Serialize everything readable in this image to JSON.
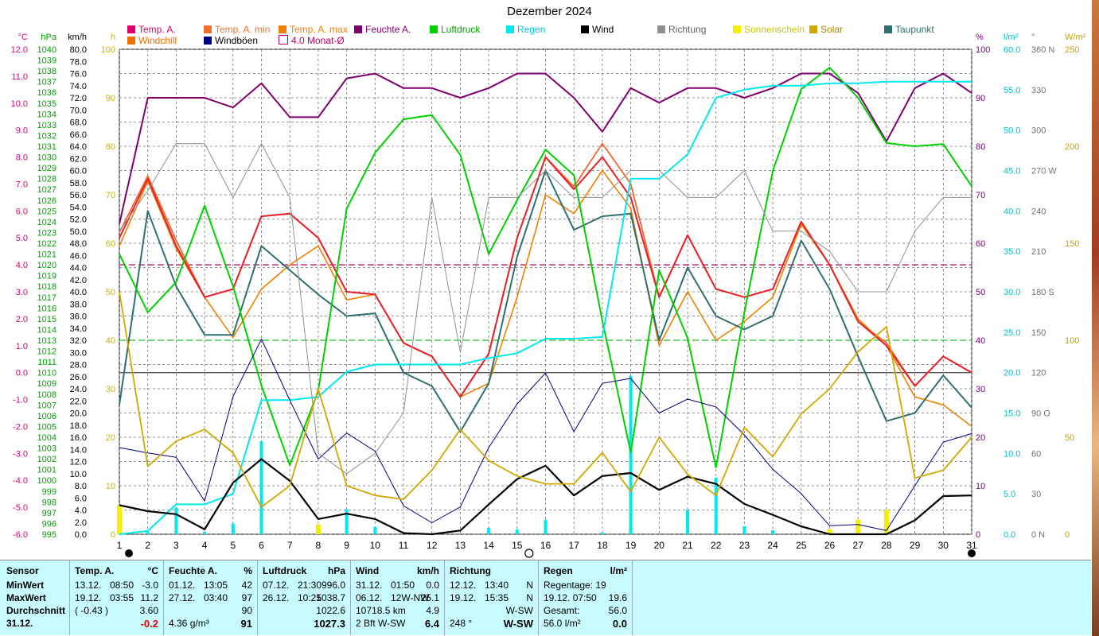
{
  "chart_data": {
    "type": "line",
    "title": "Dezember 2024",
    "x": [
      1,
      2,
      3,
      4,
      5,
      6,
      7,
      8,
      9,
      10,
      11,
      12,
      13,
      14,
      15,
      16,
      17,
      18,
      19,
      20,
      21,
      22,
      23,
      24,
      25,
      26,
      27,
      28,
      29,
      30,
      31
    ],
    "x_tick_labels": [
      "1",
      "2",
      "3",
      "4",
      "5",
      "6",
      "7",
      "8",
      "9",
      "10",
      "11",
      "12",
      "13",
      "14",
      "15",
      "16",
      "17",
      "18",
      "19",
      "20",
      "21",
      "22",
      "23",
      "24",
      "25",
      "26",
      "27",
      "28",
      "29",
      "30",
      "31"
    ],
    "axes": {
      "temp_c": {
        "label": "°C",
        "min": -6,
        "max": 12,
        "ticks": [
          "12.0",
          "11.0",
          "10.0",
          "9.0",
          "8.0",
          "7.0",
          "6.0",
          "5.0",
          "4.0",
          "3.0",
          "2.0",
          "1.0",
          "0.0",
          "-1.0",
          "-2.0",
          "-3.0",
          "-4.0",
          "-5.0",
          "-6.0"
        ],
        "color": "#e0007a"
      },
      "pressure_hpa": {
        "label": "hPa",
        "min": 995,
        "max": 1040,
        "ticks": [
          "1040",
          "1039",
          "1038",
          "1037",
          "1036",
          "1035",
          "1034",
          "1033",
          "1032",
          "1031",
          "1030",
          "1029",
          "1028",
          "1027",
          "1026",
          "1025",
          "1024",
          "1023",
          "1022",
          "1021",
          "1020",
          "1019",
          "1018",
          "1017",
          "1016",
          "1015",
          "1014",
          "1013",
          "1012",
          "1011",
          "1010",
          "1009",
          "1008",
          "1007",
          "1006",
          "1005",
          "1004",
          "1003",
          "1002",
          "1001",
          "1000",
          "999",
          "998",
          "997",
          "996",
          "995"
        ],
        "color": "#00a000"
      },
      "wind_kmh": {
        "label": "km/h",
        "min": 0,
        "max": 80,
        "ticks": [
          "80.0",
          "78.0",
          "76.0",
          "74.0",
          "72.0",
          "70.0",
          "68.0",
          "66.0",
          "64.0",
          "62.0",
          "60.0",
          "58.0",
          "56.0",
          "54.0",
          "52.0",
          "50.0",
          "48.0",
          "46.0",
          "44.0",
          "42.0",
          "40.0",
          "38.0",
          "36.0",
          "34.0",
          "32.0",
          "30.0",
          "28.0",
          "26.0",
          "24.0",
          "22.0",
          "20.0",
          "18.0",
          "16.0",
          "14.0",
          "12.0",
          "10.0",
          "8.0",
          "6.0",
          "4.0",
          "2.0",
          "0.0"
        ],
        "color": "#000000"
      },
      "sun_h": {
        "label": "h",
        "min": 0,
        "max": 100,
        "ticks": [
          "100",
          "90",
          "80",
          "70",
          "60",
          "50",
          "40",
          "30",
          "20",
          "10",
          "0"
        ],
        "color": "#c8b400"
      },
      "humidity_pct": {
        "label": "%",
        "min": 0,
        "max": 100,
        "ticks": [
          "100",
          "90",
          "80",
          "70",
          "60",
          "50",
          "40",
          "30",
          "20",
          "10",
          "0"
        ],
        "color": "#800080"
      },
      "rain_lm2": {
        "label": "l/m²",
        "min": 0,
        "max": 60,
        "ticks": [
          "60.0",
          "55.0",
          "50.0",
          "45.0",
          "40.0",
          "35.0",
          "30.0",
          "25.0",
          "20.0",
          "15.0",
          "10.0",
          "5.0",
          "0.0"
        ],
        "color": "#00c0d0"
      },
      "direction_deg": {
        "label": "°",
        "min": 0,
        "max": 360,
        "ticks": [
          "360 N",
          "330",
          "300",
          "270 W",
          "240",
          "210",
          "180 S",
          "150",
          "120",
          "90 O",
          "60",
          "30",
          "0 N"
        ],
        "color": "#707070"
      },
      "solar_wm2": {
        "label": "W/m²",
        "min": 0,
        "max": 250,
        "ticks": [
          "250",
          "200",
          "150",
          "100",
          "50",
          "0"
        ],
        "color": "#c8a000"
      }
    },
    "legend": [
      {
        "name": "Temp. A.",
        "color": "#e0006a"
      },
      {
        "name": "Temp. A. min",
        "color": "#f07030"
      },
      {
        "name": "Temp. A. max",
        "color": "#f08000"
      },
      {
        "name": "Feuchte A.",
        "color": "#800070"
      },
      {
        "name": "Luftdruck",
        "color": "#00d000"
      },
      {
        "name": "Regen",
        "color": "#00e8f0"
      },
      {
        "name": "Wind",
        "color": "#000000"
      },
      {
        "name": "Richtung",
        "color": "#909090"
      },
      {
        "name": "Sonnenschein",
        "color": "#f0f000"
      },
      {
        "name": "Solar",
        "color": "#d0a800"
      },
      {
        "name": "Taupunkt",
        "color": "#2f6f6f"
      },
      {
        "name": "Windchill",
        "color": "#f07000"
      },
      {
        "name": "Windböen",
        "color": "#000080"
      },
      {
        "name": "4.0 Monat-Ø",
        "color": "#c00060"
      }
    ],
    "reference_lines": {
      "monthly_mean_temp": 4.0,
      "dewpoint_mean": 1.2
    },
    "series": [
      {
        "name": "Temp. A. min",
        "axis": "temp_c",
        "color": "#f06a30",
        "values": [
          5.2,
          7.3,
          4.9,
          2.8,
          3.1,
          5.8,
          5.9,
          5.0,
          3.0,
          2.9,
          1.1,
          0.6,
          -0.9,
          0.7,
          5.0,
          8.0,
          6.9,
          8.5,
          7.0,
          2.8,
          5.1,
          3.1,
          2.8,
          3.1,
          5.6,
          4.0,
          1.9,
          1.1,
          -0.5,
          0.6,
          0.0
        ]
      },
      {
        "name": "Temp. A. max",
        "axis": "temp_c",
        "color": "#f08000",
        "values": [
          4.7,
          7.1,
          4.6,
          2.8,
          1.3,
          3.1,
          4.0,
          4.7,
          2.7,
          2.9,
          1.1,
          0.6,
          -0.9,
          -0.4,
          2.8,
          6.6,
          5.9,
          7.5,
          6.1,
          1.0,
          3.0,
          1.2,
          1.9,
          2.8,
          5.5,
          4.0,
          2.0,
          1.0,
          -0.9,
          -1.2,
          -2.0
        ]
      },
      {
        "name": "Temp. A.",
        "axis": "temp_c",
        "color": "#e8202a",
        "values": [
          5.0,
          7.2,
          4.7,
          2.8,
          3.1,
          5.8,
          5.9,
          5.0,
          3.0,
          2.9,
          1.1,
          0.6,
          -0.9,
          0.7,
          5.0,
          8.0,
          6.8,
          8.0,
          6.5,
          2.8,
          5.1,
          3.1,
          2.8,
          3.1,
          5.6,
          4.0,
          1.9,
          1.0,
          -0.5,
          0.6,
          0.0
        ]
      },
      {
        "name": "Taupunkt",
        "axis": "temp_c",
        "color": "#2f6f6f",
        "values": [
          -1.2,
          6.0,
          3.2,
          1.4,
          1.4,
          4.7,
          3.8,
          2.9,
          2.1,
          2.2,
          0.0,
          -0.5,
          -2.2,
          -0.4,
          4.3,
          7.5,
          5.3,
          5.8,
          5.9,
          1.2,
          3.9,
          2.1,
          1.6,
          2.1,
          4.9,
          3.1,
          0.6,
          -1.8,
          -1.5,
          -0.1,
          -1.3
        ]
      },
      {
        "name": "Feuchte A.",
        "axis": "humidity_pct",
        "color": "#800070",
        "values": [
          64,
          90,
          90,
          90,
          88,
          93,
          86,
          86,
          94,
          95,
          92,
          92,
          90,
          92,
          95,
          95,
          90,
          83,
          92,
          89,
          92,
          92,
          90,
          92,
          95,
          95,
          91,
          81,
          92,
          95,
          91
        ]
      },
      {
        "name": "Luftdruck",
        "axis": "pressure_hpa",
        "color": "#00d000",
        "values": [
          1021.0,
          1015.6,
          1018.4,
          1025.5,
          1018.0,
          1008.8,
          1001.4,
          1008.3,
          1025.2,
          1030.4,
          1033.5,
          1033.9,
          1030.2,
          1021.0,
          1026.0,
          1030.7,
          1028.3,
          1014.8,
          1002.6,
          1019.5,
          1013.2,
          1001.2,
          1015.6,
          1028.7,
          1036.3,
          1038.3,
          1035.5,
          1031.3,
          1031.0,
          1031.2,
          1027.3
        ]
      },
      {
        "name": "Regen",
        "axis": "rain_lm2",
        "color": "#00e8f0",
        "values": [
          0.0,
          0.4,
          3.7,
          3.7,
          5.0,
          16.6,
          16.6,
          17.0,
          20.1,
          21.0,
          21.0,
          21.0,
          21.0,
          21.8,
          22.4,
          24.2,
          24.2,
          24.4,
          44.0,
          44.0,
          47.0,
          54.0,
          55.0,
          55.5,
          55.5,
          55.8,
          55.8,
          56.0,
          56.0,
          56.0,
          56.0
        ]
      },
      {
        "name": "Wind",
        "axis": "wind_kmh",
        "color": "#000000",
        "values": [
          4.8,
          3.8,
          3.3,
          0.8,
          8.5,
          12.4,
          8.8,
          2.5,
          3.4,
          2.5,
          0.2,
          0.0,
          0.6,
          4.9,
          9.1,
          11.3,
          6.4,
          9.6,
          10.1,
          7.3,
          9.5,
          8.3,
          5.0,
          3.2,
          1.3,
          0.0,
          0.0,
          0.0,
          2.3,
          6.3,
          6.4
        ]
      },
      {
        "name": "Windböen",
        "axis": "wind_kmh",
        "color": "#000080",
        "values": [
          14.3,
          13.4,
          12.7,
          5.5,
          22.7,
          32.2,
          22.1,
          12.4,
          16.7,
          13.7,
          4.7,
          1.9,
          4.5,
          14.3,
          21.5,
          26.6,
          16.9,
          24.9,
          25.7,
          20.0,
          22.3,
          21.0,
          16.4,
          10.7,
          6.7,
          1.4,
          1.6,
          0.6,
          8.0,
          15.2,
          16.6
        ]
      },
      {
        "name": "Richtung",
        "axis": "direction_deg",
        "color": "#909090",
        "values": [
          225,
          255,
          290,
          290,
          250,
          290,
          250,
          60,
          45,
          60,
          90,
          250,
          135,
          250,
          250,
          270,
          250,
          250,
          270,
          270,
          250,
          250,
          270,
          225,
          225,
          210,
          180,
          180,
          225,
          250,
          250
        ]
      },
      {
        "name": "Solar",
        "axis": "solar_wm2",
        "color": "#d0a800",
        "values": [
          125,
          35,
          48,
          54,
          42,
          14,
          25,
          75,
          25,
          20,
          18,
          33,
          54,
          38,
          30,
          26,
          26,
          42,
          22,
          50,
          31,
          20,
          55,
          40,
          62,
          75,
          94,
          107,
          29,
          33,
          50
        ]
      }
    ],
    "rain_bars": {
      "name": "Regen (Tagesmenge)",
      "axis": "rain_lm2",
      "color": "#00e8f0",
      "values": [
        2.0,
        0.3,
        3.3,
        0.3,
        1.3,
        11.5,
        0.0,
        0.4,
        3.1,
        0.9,
        0.0,
        0.0,
        0.0,
        0.8,
        0.6,
        1.8,
        0.0,
        0.2,
        19.6,
        0.0,
        3.0,
        7.0,
        1.0,
        0.5,
        0.0,
        0.3,
        0.0,
        0.2,
        0.0,
        0.0,
        0.0
      ]
    },
    "sun_bars": {
      "name": "Sonnenschein",
      "axis": "sun_h",
      "color": "#f0f000",
      "values": [
        6,
        0,
        0,
        0,
        0,
        0,
        0,
        2,
        0,
        0,
        0,
        0,
        0,
        0,
        0,
        0,
        0,
        0,
        0,
        0,
        0,
        0,
        0,
        0,
        0,
        1,
        3,
        5,
        0,
        0,
        0
      ]
    },
    "grid": true
  },
  "stats": {
    "col1": {
      "header": "Sensor",
      "rows": [
        "MinWert",
        "MaxWert",
        "Durchschnitt",
        "31.12."
      ]
    },
    "col2": {
      "header": "Temp. A.",
      "unit": "°C",
      "rows": [
        [
          "13.12.",
          "08:50",
          "-3.0"
        ],
        [
          "19.12.",
          "03:55",
          "11.2"
        ],
        [
          "( -0.43 )",
          "",
          "3.60"
        ],
        [
          "",
          "",
          "-0.2"
        ]
      ]
    },
    "col3": {
      "header": "Feuchte A.",
      "unit": "%",
      "rows": [
        [
          "01.12.",
          "13:05",
          "42"
        ],
        [
          "27.12.",
          "03:40",
          "97"
        ],
        [
          "",
          "",
          "90"
        ],
        [
          "4.36 g/m³",
          "",
          "91"
        ]
      ]
    },
    "col4": {
      "header": "Luftdruck",
      "unit": "hPa",
      "rows": [
        [
          "07.12.",
          "21:30",
          "996.0"
        ],
        [
          "26.12.",
          "10:25",
          "1038.7"
        ],
        [
          "",
          "",
          "1022.6"
        ],
        [
          "",
          "",
          "1027.3"
        ]
      ]
    },
    "col5": {
      "header": "Wind",
      "unit": "km/h",
      "rows": [
        [
          "31.12.",
          "01:50",
          "0.0"
        ],
        [
          "06.12.",
          "12W-NW",
          "25.1"
        ],
        [
          "10718.5 km",
          "",
          "4.9"
        ],
        [
          "2 Bft W-SW",
          "",
          "6.4"
        ]
      ]
    },
    "col6": {
      "header": "Richtung",
      "rows": [
        [
          "12.12.",
          "13:40",
          "N"
        ],
        [
          "19.12.",
          "15:35",
          "N"
        ],
        [
          "",
          "",
          "W-SW"
        ],
        [
          "248 °",
          "",
          "W-SW"
        ]
      ]
    },
    "col7": {
      "header": "Regen",
      "unit": "l/m²",
      "rows": [
        [
          "Regentage: 19",
          ""
        ],
        [
          "19.12.  07:50",
          "19.6"
        ],
        [
          "Gesamt:",
          "56.0"
        ],
        [
          "56.0 l/m²",
          "0.0"
        ]
      ]
    }
  }
}
